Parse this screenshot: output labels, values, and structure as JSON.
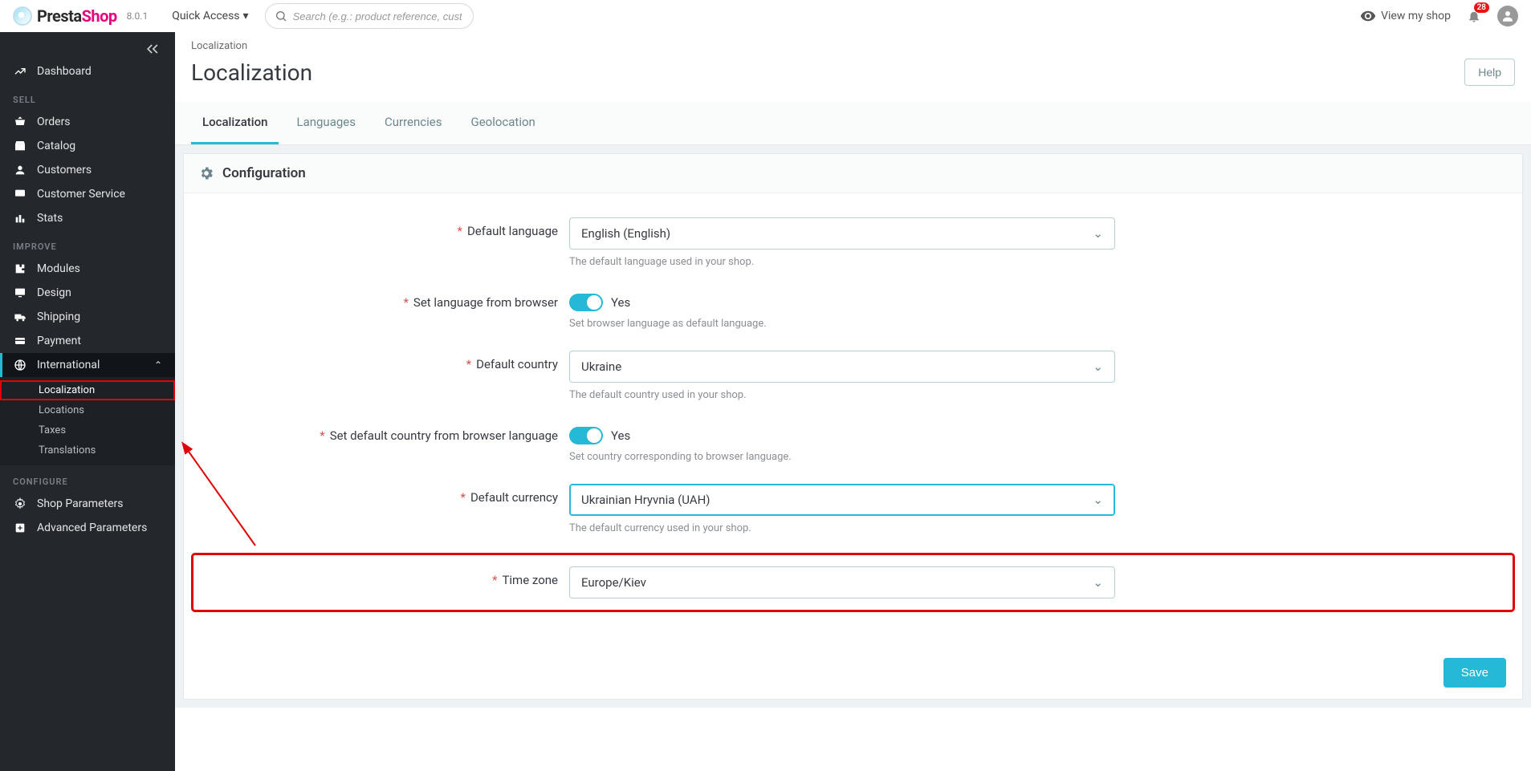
{
  "brand": {
    "name1": "Presta",
    "name2": "Shop",
    "version": "8.0.1"
  },
  "top": {
    "quick_access": "Quick Access",
    "search_placeholder": "Search (e.g.: product reference, custon",
    "view_shop": "View my shop",
    "notif_count": "28"
  },
  "sidebar": {
    "dashboard": "Dashboard",
    "sections": {
      "sell": "SELL",
      "improve": "IMPROVE",
      "configure": "CONFIGURE"
    },
    "sell_items": {
      "orders": "Orders",
      "catalog": "Catalog",
      "customers": "Customers",
      "customer_service": "Customer Service",
      "stats": "Stats"
    },
    "improve_items": {
      "modules": "Modules",
      "design": "Design",
      "shipping": "Shipping",
      "payment": "Payment",
      "international": "International"
    },
    "intl_sub": {
      "localization": "Localization",
      "locations": "Locations",
      "taxes": "Taxes",
      "translations": "Translations"
    },
    "configure_items": {
      "shop_params": "Shop Parameters",
      "advanced_params": "Advanced Parameters"
    }
  },
  "page": {
    "breadcrumb": "Localization",
    "title": "Localization",
    "help": "Help",
    "tabs": {
      "localization": "Localization",
      "languages": "Languages",
      "currencies": "Currencies",
      "geolocation": "Geolocation"
    }
  },
  "card": {
    "title": "Configuration",
    "fields": {
      "default_language": {
        "label": "Default language",
        "value": "English (English)",
        "help": "The default language used in your shop."
      },
      "lang_from_browser": {
        "label": "Set language from browser",
        "value": "Yes",
        "help": "Set browser language as default language."
      },
      "default_country": {
        "label": "Default country",
        "value": "Ukraine",
        "help": "The default country used in your shop."
      },
      "country_from_browser": {
        "label": "Set default country from browser language",
        "value": "Yes",
        "help": "Set country corresponding to browser language."
      },
      "default_currency": {
        "label": "Default currency",
        "value": "Ukrainian Hryvnia (UAH)",
        "help": "The default currency used in your shop."
      },
      "time_zone": {
        "label": "Time zone",
        "value": "Europe/Kiev"
      }
    },
    "save": "Save"
  }
}
